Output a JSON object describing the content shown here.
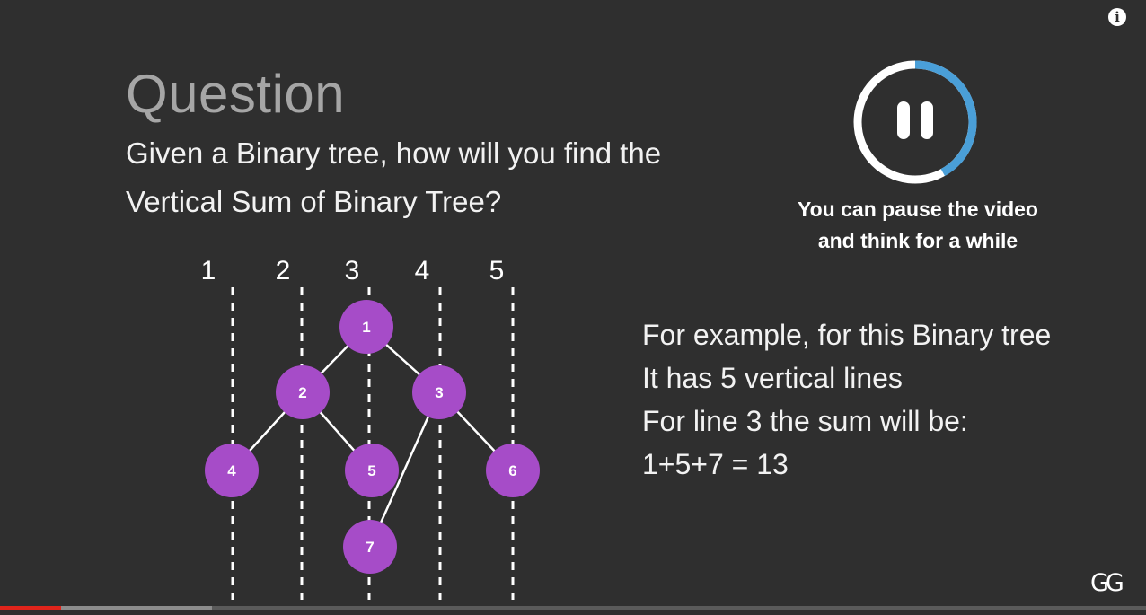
{
  "info_button": {
    "icon": "info-icon",
    "label": "i"
  },
  "slide": {
    "heading": "Question",
    "question_lines": [
      "Given a Binary tree, how will you find the",
      "Vertical Sum of Binary Tree?"
    ],
    "pause_prompt": {
      "icon": "pause-icon",
      "progress": 0.42,
      "lines": [
        "You can pause the video",
        "and think for a while"
      ]
    },
    "vertical_lines": [
      "1",
      "2",
      "3",
      "4",
      "5"
    ],
    "tree_nodes": [
      {
        "id": "1",
        "label": "1"
      },
      {
        "id": "2",
        "label": "2"
      },
      {
        "id": "3",
        "label": "3"
      },
      {
        "id": "4",
        "label": "4"
      },
      {
        "id": "5",
        "label": "5"
      },
      {
        "id": "6",
        "label": "6"
      },
      {
        "id": "7",
        "label": "7"
      }
    ],
    "tree_edges": [
      [
        "1",
        "2"
      ],
      [
        "1",
        "3"
      ],
      [
        "2",
        "4"
      ],
      [
        "2",
        "5"
      ],
      [
        "3",
        "7"
      ],
      [
        "3",
        "6"
      ]
    ],
    "example_lines": [
      "For example, for this Binary tree",
      "It has 5 vertical lines",
      "For line 3 the sum will be:",
      "1+5+7 = 13"
    ]
  },
  "logo": {
    "text": "GG",
    "icon": "geeksforgeeks-logo"
  },
  "player": {
    "played_fraction": 0.053,
    "buffered_fraction": 0.185
  },
  "colors": {
    "background": "#2f2f2f",
    "node_fill": "#a64cc8",
    "ring_accent": "#4a9fd8",
    "progress_red": "#e0241b"
  }
}
